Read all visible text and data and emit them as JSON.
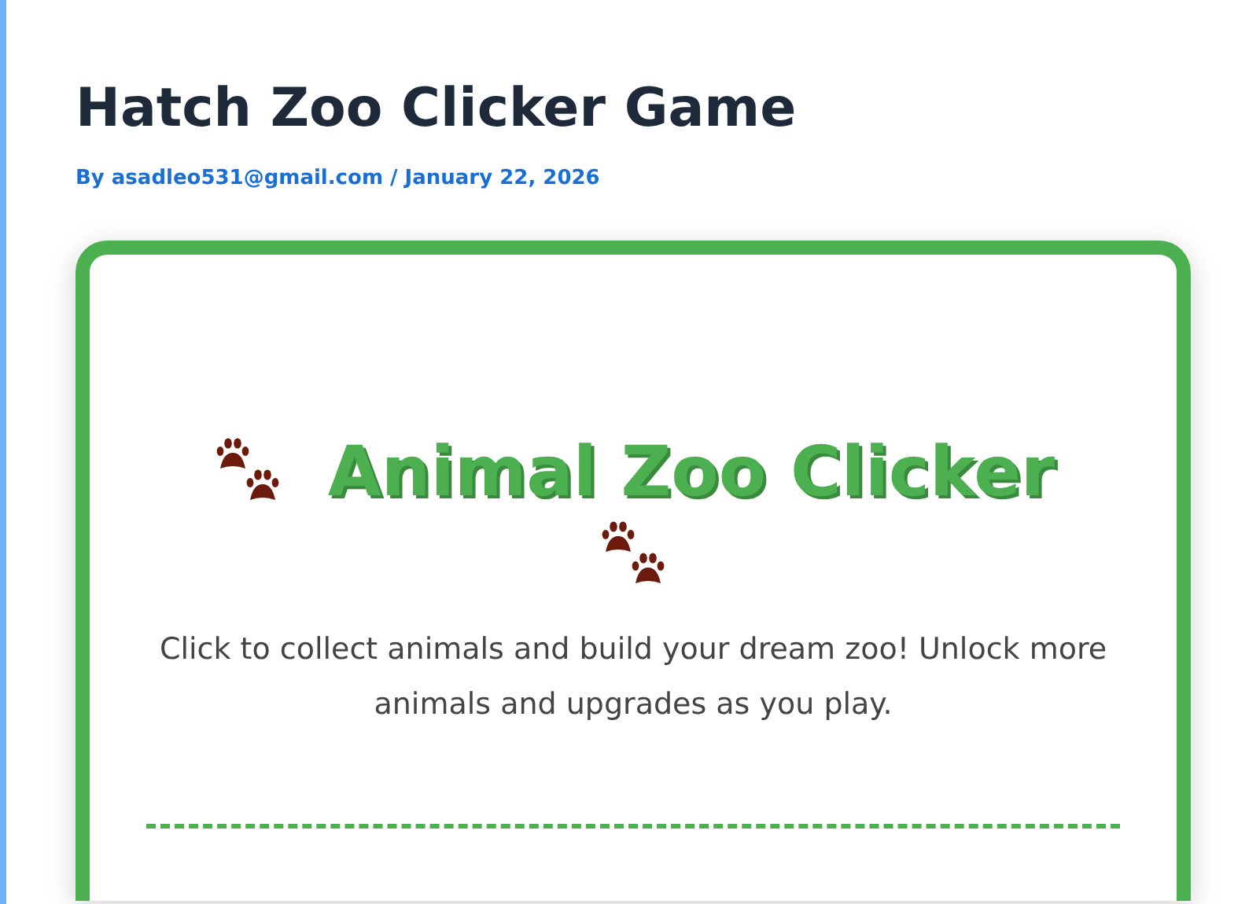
{
  "post": {
    "title": "Hatch Zoo Clicker Game",
    "byline": "By asadleo531@gmail.com / January 22, 2026"
  },
  "game": {
    "heading": "Animal Zoo Clicker",
    "description": "Click to collect animals and build your dream zoo! Unlock more animals and upgrades as you play."
  }
}
